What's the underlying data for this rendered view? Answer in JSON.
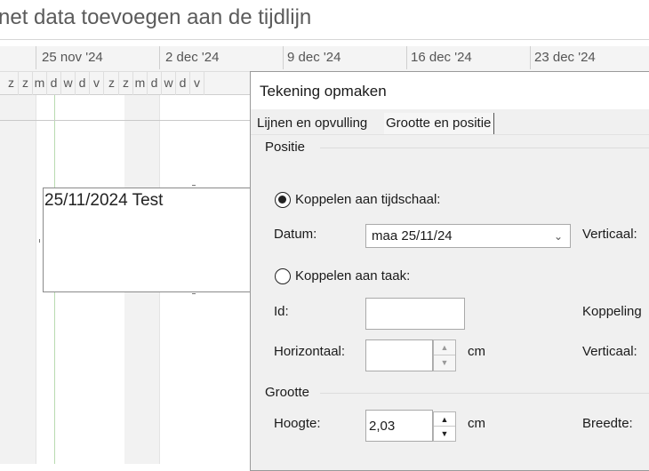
{
  "timeline_text": "net data toevoegen aan de tijdlijn",
  "gantt": {
    "weeks": [
      "25 nov '24",
      "2 dec '24",
      "9 dec '24",
      "16 dec '24",
      "23 dec '24"
    ],
    "days": [
      "z",
      "z",
      "m",
      "d",
      "w",
      "d",
      "v",
      "z",
      "z",
      "m",
      "d",
      "w",
      "d",
      "v"
    ],
    "drawing_text": "25/11/2024 Test"
  },
  "dialog": {
    "title": "Tekening opmaken",
    "tabs": [
      "Lijnen en opvulling",
      "Grootte en positie"
    ],
    "position_section": "Positie",
    "radio_timescale": "Koppelen aan tijdschaal:",
    "date_label": "Datum:",
    "date_value": "maa 25/11/24",
    "vertical_label": "Verticaal:",
    "radio_task": "Koppelen aan taak:",
    "id_label": "Id:",
    "id_value": "",
    "link_label": "Koppeling",
    "horizontal_label": "Horizontaal:",
    "horizontal_value": "",
    "unit_cm": "cm",
    "vertical_label2": "Verticaal:",
    "size_section": "Grootte",
    "height_label": "Hoogte:",
    "height_value": "2,03",
    "width_label": "Breedte:"
  }
}
